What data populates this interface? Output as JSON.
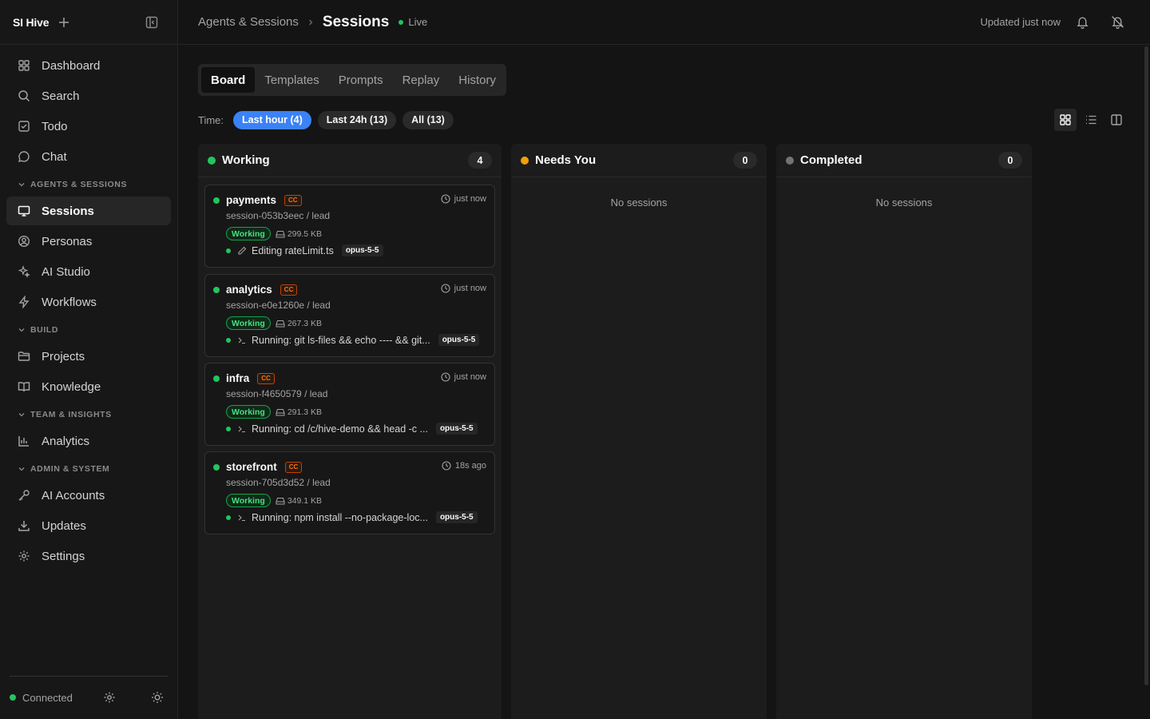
{
  "app": {
    "brand": "SI Hive"
  },
  "sidebar": {
    "items_top": [
      {
        "label": "Dashboard",
        "icon": "grid-icon"
      },
      {
        "label": "Search",
        "icon": "search-icon"
      },
      {
        "label": "Todo",
        "icon": "checkbox-icon"
      },
      {
        "label": "Chat",
        "icon": "chat-icon"
      }
    ],
    "sections": [
      {
        "title": "AGENTS & SESSIONS",
        "items": [
          {
            "label": "Sessions",
            "icon": "monitor-icon",
            "active": true
          },
          {
            "label": "Personas",
            "icon": "user-circle-icon"
          },
          {
            "label": "AI Studio",
            "icon": "sparkles-icon"
          },
          {
            "label": "Workflows",
            "icon": "bolt-icon"
          }
        ]
      },
      {
        "title": "BUILD",
        "items": [
          {
            "label": "Projects",
            "icon": "folder-icon"
          },
          {
            "label": "Knowledge",
            "icon": "book-icon"
          }
        ]
      },
      {
        "title": "TEAM & INSIGHTS",
        "items": [
          {
            "label": "Analytics",
            "icon": "bar-chart-icon"
          }
        ]
      },
      {
        "title": "ADMIN & SYSTEM",
        "items": [
          {
            "label": "AI Accounts",
            "icon": "key-icon"
          },
          {
            "label": "Updates",
            "icon": "download-icon"
          },
          {
            "label": "Settings",
            "icon": "gear-icon"
          }
        ]
      }
    ],
    "footer": {
      "status": "Connected"
    }
  },
  "header": {
    "breadcrumb": "Agents & Sessions",
    "title": "Sessions",
    "live_label": "Live",
    "updated": "Updated just now"
  },
  "tabs": [
    "Board",
    "Templates",
    "Prompts",
    "Replay",
    "History"
  ],
  "filter": {
    "label": "Time:",
    "options": [
      "Last hour (4)",
      "Last 24h (13)",
      "All (13)"
    ],
    "selected": "Last hour (4)"
  },
  "board": {
    "columns": [
      {
        "title": "Working",
        "count": "4",
        "status_color": "#22c55e"
      },
      {
        "title": "Needs You",
        "count": "0",
        "status_color": "#f59e0b",
        "empty_text": "No sessions"
      },
      {
        "title": "Completed",
        "count": "0",
        "status_color": "#737373",
        "empty_text": "No sessions"
      }
    ],
    "cards": [
      {
        "name": "payments",
        "tag": "CC",
        "time": "just now",
        "session": "session-053b3eec / lead",
        "status": "Working",
        "size": "299.5 KB",
        "activity_icon": "pencil-icon",
        "activity": "Editing rateLimit.ts",
        "model": "opus-5-5"
      },
      {
        "name": "analytics",
        "tag": "CC",
        "time": "just now",
        "session": "session-e0e1260e / lead",
        "status": "Working",
        "size": "267.3 KB",
        "activity_icon": "terminal-icon",
        "activity": "Running: git ls-files && echo ---- && git...",
        "model": "opus-5-5"
      },
      {
        "name": "infra",
        "tag": "CC",
        "time": "just now",
        "session": "session-f4650579 / lead",
        "status": "Working",
        "size": "291.3 KB",
        "activity_icon": "terminal-icon",
        "activity": "Running: cd /c/hive-demo && head -c ...",
        "model": "opus-5-5"
      },
      {
        "name": "storefront",
        "tag": "CC",
        "time": "18s ago",
        "session": "session-705d3d52 / lead",
        "status": "Working",
        "size": "349.1 KB",
        "activity_icon": "terminal-icon",
        "activity": "Running: npm install --no-package-loc...",
        "model": "opus-5-5"
      }
    ]
  },
  "colors": {
    "accent": "#3b82f6",
    "working": "#22c55e",
    "needs": "#f59e0b",
    "cc": "#f97316"
  }
}
